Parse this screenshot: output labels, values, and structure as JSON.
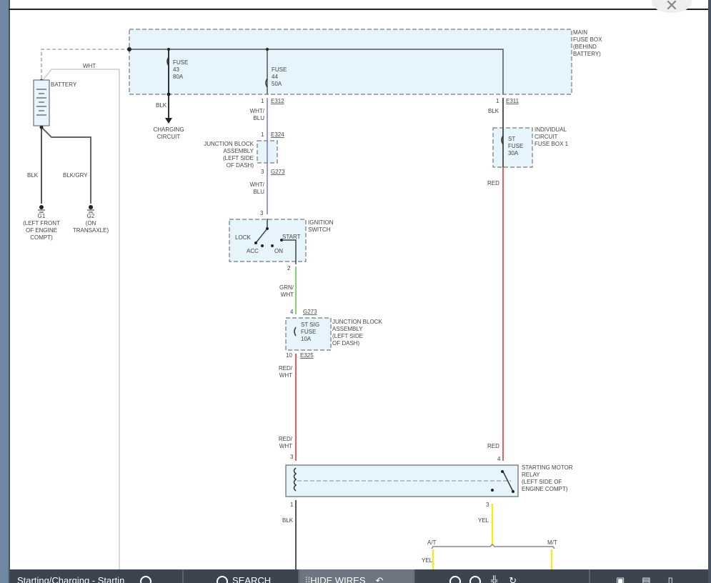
{
  "diagram": {
    "main_fuse_box": [
      "MAIN",
      "FUSE BOX",
      "(BEHIND",
      "BATTERY)"
    ],
    "battery": "BATTERY",
    "wht": "WHT",
    "fuse43": [
      "FUSE",
      "43",
      "80A"
    ],
    "fuse44": [
      "FUSE",
      "44",
      "50A"
    ],
    "blk_charging": "BLK",
    "charging_circuit": [
      "CHARGING",
      "CIRCUIT"
    ],
    "e312": {
      "pin": "1",
      "id": "E312"
    },
    "wht_blu_1": [
      "WHT/",
      "BLU"
    ],
    "e324": {
      "pin": "1",
      "id": "E324"
    },
    "junction_block_1": [
      "JUNCTION BLOCK",
      "ASSEMBLY",
      "(LEFT SIDE",
      "OF DASH)"
    ],
    "g273_a": {
      "pin": "3",
      "id": "G273"
    },
    "wht_blu_2": [
      "WHT/",
      "BLU"
    ],
    "blk_g1": "BLK",
    "blk_gry": "BLK/GRY",
    "g1": [
      "G1",
      "(LEFT FRONT",
      "OF ENGINE",
      "COMPT)"
    ],
    "g2": [
      "G2",
      "(ON",
      "TRANSAXLE)"
    ],
    "ign_pin_in": "3",
    "ignition_switch": [
      "IGNITION",
      "SWITCH"
    ],
    "ign_positions": {
      "lock": "LOCK",
      "acc": "ACC",
      "on": "ON",
      "start": "START"
    },
    "ign_pin_out": "2",
    "grn_wht": [
      "GRN/",
      "WHT"
    ],
    "g273_b": {
      "pin": "4",
      "id": "G273"
    },
    "st_sig_fuse": [
      "ST SIG",
      "FUSE",
      "10A"
    ],
    "junction_block_2": [
      "JUNCTION BLOCK",
      "ASSEMBLY",
      "(LEFT SIDE",
      "OF DASH)"
    ],
    "e325": {
      "pin": "10",
      "id": "E325"
    },
    "red_wht_1": [
      "RED/",
      "WHT"
    ],
    "red_wht_2": [
      "RED/",
      "WHT"
    ],
    "relay_pin3_in": "3",
    "e311": {
      "pin": "1",
      "id": "E311"
    },
    "blk_e311": "BLK",
    "st_fuse": [
      "ST",
      "FUSE",
      "30A"
    ],
    "indiv_fuse_box": [
      "INDIVIDUAL",
      "CIRCUIT",
      "FUSE BOX 1"
    ],
    "red_1": "RED",
    "red_2": "RED",
    "relay_pin4": "4",
    "starting_motor_relay": [
      "STARTING MOTOR",
      "RELAY",
      "(LEFT SIDE OF",
      "ENGINE COMPT)"
    ],
    "relay_pin1": "1",
    "blk_relay": "BLK",
    "relay_pin3_out": "3",
    "yel_1": "YEL",
    "at": "A/T",
    "mt": "M/T",
    "yel_2": "YEL"
  },
  "toolbar": {
    "title": "Starting/Charging - Startin",
    "search": "SEARCH",
    "hide_wires": "HIDE WIRES"
  },
  "colors": {
    "box_fill": "#e6f4fc",
    "purple": "#7b70f0",
    "green": "#5ac43a",
    "red": "#f02020",
    "yellow": "#f5f000",
    "toolbar": "#3c4450"
  }
}
